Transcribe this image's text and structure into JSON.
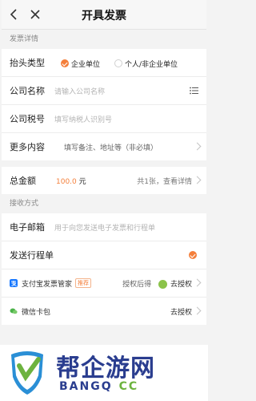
{
  "header": {
    "title": "开具发票"
  },
  "invoice_section": {
    "title": "发票详情",
    "title_type": {
      "label": "抬头类型",
      "options": [
        "企业单位",
        "个人/非企业单位"
      ],
      "selected": "企业单位"
    },
    "company_name": {
      "label": "公司名称",
      "placeholder": "请输入公司名称"
    },
    "tax_id": {
      "label": "公司税号",
      "placeholder": "填写纳税人识别号"
    },
    "more": {
      "label": "更多内容",
      "placeholder": "填写备注、地址等（非必填）"
    }
  },
  "total": {
    "label": "总金额",
    "amount": "100.0",
    "unit": "元",
    "detail": "共1张，查看详情"
  },
  "receive_section": {
    "title": "接收方式",
    "email": {
      "label": "电子邮箱",
      "placeholder": "用于向您发送电子发票和行程单"
    },
    "itinerary": {
      "label": "发送行程单",
      "checked": true
    },
    "alipay": {
      "label": "支付宝发票管家",
      "badge": "推荐",
      "status": "授权后得",
      "action": "去授权"
    },
    "wechat": {
      "label": "微信卡包",
      "action": "去授权"
    }
  },
  "watermark": {
    "cn": "帮企游网",
    "en": "BANGQ",
    "domain": "CC"
  },
  "colors": {
    "accent": "#f47f3b",
    "brand_blue": "#2a3d8f",
    "brand_green": "#6db33f"
  }
}
